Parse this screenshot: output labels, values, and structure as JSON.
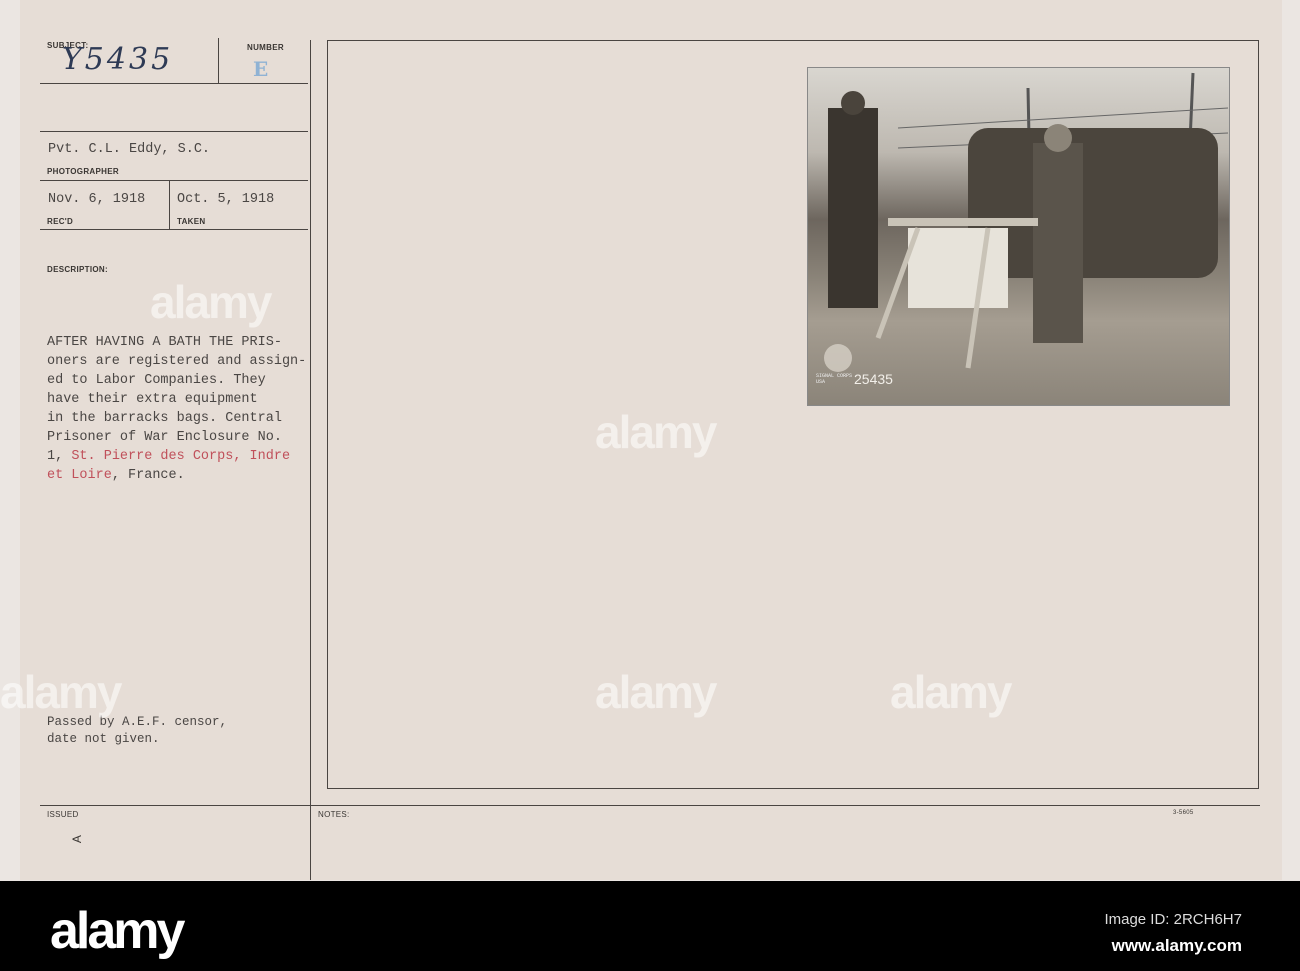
{
  "card": {
    "subject_label": "SUBJECT:",
    "subject_value": "Y5435",
    "number_label": "NUMBER",
    "number_value": "E",
    "photographer_value": "Pvt. C.L. Eddy, S.C.",
    "photographer_label": "PHOTOGRAPHER",
    "received_value": "Nov. 6, 1918",
    "received_label": "REC'D",
    "taken_value": "Oct. 5, 1918",
    "taken_label": "TAKEN",
    "description_label": "DESCRIPTION:",
    "description_lines": [
      "AFTER HAVING A BATH THE PRIS-",
      "oners are registered and assign-",
      "ed to Labor Companies. They",
      "have their extra equipment",
      "in the barracks bags. Central",
      "Prisoner of War Enclosure No.",
      "1, ",
      "St. Pierre des Corps, Indre",
      "et Loire",
      ", France."
    ],
    "censor_lines": [
      "Passed by A.E.F. censor,",
      "date not given."
    ],
    "issued_label": "ISSUED",
    "issued_mark": "A",
    "notes_label": "NOTES:",
    "form_number": "3-5605",
    "photo_number": "25435",
    "photo_stamp": "SIGNAL CORPS USA"
  },
  "watermark": "alamy",
  "footer": {
    "logo": "alamy",
    "image_id": "Image ID: 2RCH6H7",
    "url": "www.alamy.com"
  }
}
